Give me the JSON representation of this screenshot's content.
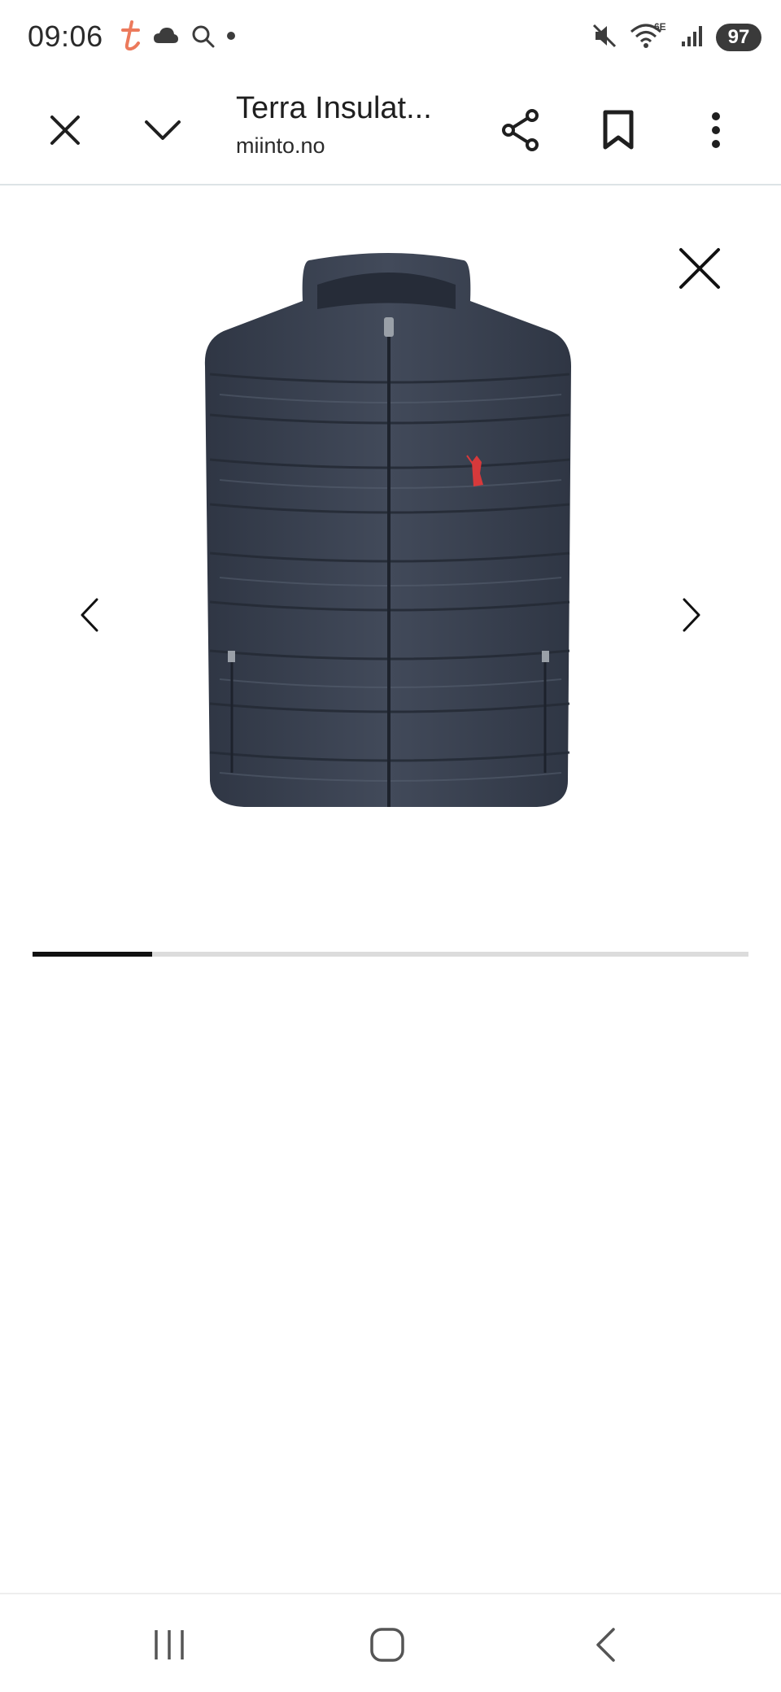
{
  "status_bar": {
    "time": "09:06",
    "left_icons": [
      "t-app-icon",
      "cloud-icon",
      "search-icon",
      "dot-icon"
    ],
    "right_icons": [
      "mute-icon",
      "wifi-6e-icon",
      "signal-icon"
    ],
    "wifi_label": "6E",
    "battery": "97"
  },
  "toolbar": {
    "title": "Terra Insulat...",
    "url": "miinto.no",
    "buttons": [
      "close-icon",
      "chevron-down-icon",
      "share-icon",
      "bookmark-icon",
      "more-vert-icon"
    ]
  },
  "gallery": {
    "image_subject": "navy quilted vest with red logo",
    "colors": {
      "vest": "#3a4150",
      "logo": "#d7393b"
    },
    "progress": 0.167
  },
  "nav_bar": {
    "buttons": [
      "recents-icon",
      "home-icon",
      "back-icon"
    ]
  }
}
